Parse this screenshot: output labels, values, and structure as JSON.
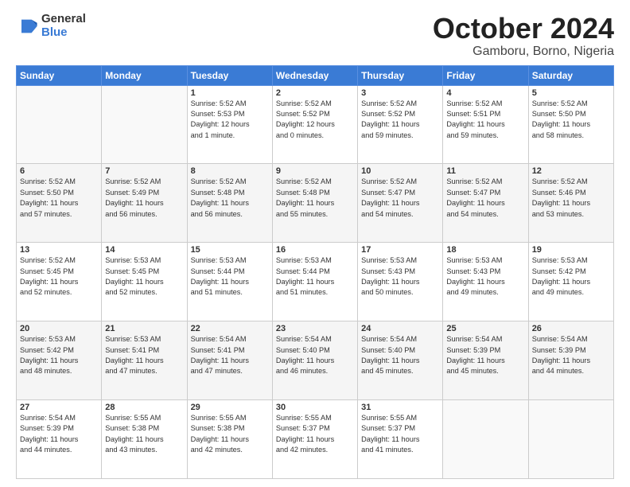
{
  "logo": {
    "general": "General",
    "blue": "Blue"
  },
  "title": {
    "month": "October 2024",
    "location": "Gamboru, Borno, Nigeria"
  },
  "weekdays": [
    "Sunday",
    "Monday",
    "Tuesday",
    "Wednesday",
    "Thursday",
    "Friday",
    "Saturday"
  ],
  "weeks": [
    [
      {
        "day": "",
        "info": ""
      },
      {
        "day": "",
        "info": ""
      },
      {
        "day": "1",
        "info": "Sunrise: 5:52 AM\nSunset: 5:53 PM\nDaylight: 12 hours\nand 1 minute."
      },
      {
        "day": "2",
        "info": "Sunrise: 5:52 AM\nSunset: 5:52 PM\nDaylight: 12 hours\nand 0 minutes."
      },
      {
        "day": "3",
        "info": "Sunrise: 5:52 AM\nSunset: 5:52 PM\nDaylight: 11 hours\nand 59 minutes."
      },
      {
        "day": "4",
        "info": "Sunrise: 5:52 AM\nSunset: 5:51 PM\nDaylight: 11 hours\nand 59 minutes."
      },
      {
        "day": "5",
        "info": "Sunrise: 5:52 AM\nSunset: 5:50 PM\nDaylight: 11 hours\nand 58 minutes."
      }
    ],
    [
      {
        "day": "6",
        "info": "Sunrise: 5:52 AM\nSunset: 5:50 PM\nDaylight: 11 hours\nand 57 minutes."
      },
      {
        "day": "7",
        "info": "Sunrise: 5:52 AM\nSunset: 5:49 PM\nDaylight: 11 hours\nand 56 minutes."
      },
      {
        "day": "8",
        "info": "Sunrise: 5:52 AM\nSunset: 5:48 PM\nDaylight: 11 hours\nand 56 minutes."
      },
      {
        "day": "9",
        "info": "Sunrise: 5:52 AM\nSunset: 5:48 PM\nDaylight: 11 hours\nand 55 minutes."
      },
      {
        "day": "10",
        "info": "Sunrise: 5:52 AM\nSunset: 5:47 PM\nDaylight: 11 hours\nand 54 minutes."
      },
      {
        "day": "11",
        "info": "Sunrise: 5:52 AM\nSunset: 5:47 PM\nDaylight: 11 hours\nand 54 minutes."
      },
      {
        "day": "12",
        "info": "Sunrise: 5:52 AM\nSunset: 5:46 PM\nDaylight: 11 hours\nand 53 minutes."
      }
    ],
    [
      {
        "day": "13",
        "info": "Sunrise: 5:52 AM\nSunset: 5:45 PM\nDaylight: 11 hours\nand 52 minutes."
      },
      {
        "day": "14",
        "info": "Sunrise: 5:53 AM\nSunset: 5:45 PM\nDaylight: 11 hours\nand 52 minutes."
      },
      {
        "day": "15",
        "info": "Sunrise: 5:53 AM\nSunset: 5:44 PM\nDaylight: 11 hours\nand 51 minutes."
      },
      {
        "day": "16",
        "info": "Sunrise: 5:53 AM\nSunset: 5:44 PM\nDaylight: 11 hours\nand 51 minutes."
      },
      {
        "day": "17",
        "info": "Sunrise: 5:53 AM\nSunset: 5:43 PM\nDaylight: 11 hours\nand 50 minutes."
      },
      {
        "day": "18",
        "info": "Sunrise: 5:53 AM\nSunset: 5:43 PM\nDaylight: 11 hours\nand 49 minutes."
      },
      {
        "day": "19",
        "info": "Sunrise: 5:53 AM\nSunset: 5:42 PM\nDaylight: 11 hours\nand 49 minutes."
      }
    ],
    [
      {
        "day": "20",
        "info": "Sunrise: 5:53 AM\nSunset: 5:42 PM\nDaylight: 11 hours\nand 48 minutes."
      },
      {
        "day": "21",
        "info": "Sunrise: 5:53 AM\nSunset: 5:41 PM\nDaylight: 11 hours\nand 47 minutes."
      },
      {
        "day": "22",
        "info": "Sunrise: 5:54 AM\nSunset: 5:41 PM\nDaylight: 11 hours\nand 47 minutes."
      },
      {
        "day": "23",
        "info": "Sunrise: 5:54 AM\nSunset: 5:40 PM\nDaylight: 11 hours\nand 46 minutes."
      },
      {
        "day": "24",
        "info": "Sunrise: 5:54 AM\nSunset: 5:40 PM\nDaylight: 11 hours\nand 45 minutes."
      },
      {
        "day": "25",
        "info": "Sunrise: 5:54 AM\nSunset: 5:39 PM\nDaylight: 11 hours\nand 45 minutes."
      },
      {
        "day": "26",
        "info": "Sunrise: 5:54 AM\nSunset: 5:39 PM\nDaylight: 11 hours\nand 44 minutes."
      }
    ],
    [
      {
        "day": "27",
        "info": "Sunrise: 5:54 AM\nSunset: 5:39 PM\nDaylight: 11 hours\nand 44 minutes."
      },
      {
        "day": "28",
        "info": "Sunrise: 5:55 AM\nSunset: 5:38 PM\nDaylight: 11 hours\nand 43 minutes."
      },
      {
        "day": "29",
        "info": "Sunrise: 5:55 AM\nSunset: 5:38 PM\nDaylight: 11 hours\nand 42 minutes."
      },
      {
        "day": "30",
        "info": "Sunrise: 5:55 AM\nSunset: 5:37 PM\nDaylight: 11 hours\nand 42 minutes."
      },
      {
        "day": "31",
        "info": "Sunrise: 5:55 AM\nSunset: 5:37 PM\nDaylight: 11 hours\nand 41 minutes."
      },
      {
        "day": "",
        "info": ""
      },
      {
        "day": "",
        "info": ""
      }
    ]
  ]
}
